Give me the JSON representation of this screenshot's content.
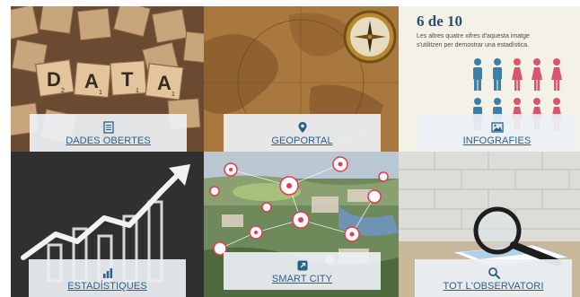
{
  "tiles": [
    {
      "label": "DADES OBERTES",
      "icon": "document-list-icon"
    },
    {
      "label": "GEOPORTAL",
      "icon": "map-pin-icon"
    },
    {
      "label": "INFOGRAFIES",
      "icon": "image-icon"
    },
    {
      "label": "ESTADÍSTIQUES",
      "icon": "bar-chart-icon"
    },
    {
      "label": "SMART CITY",
      "icon": "external-link-icon"
    },
    {
      "label": "TOT L'OBSERVATORI",
      "icon": "search-icon"
    }
  ],
  "data_blocks": {
    "d": "D",
    "d_sub": "2",
    "a1": "A",
    "a1_sub": "1",
    "t": "T",
    "t_sub": "1",
    "a2": "A",
    "a2_sub": "1"
  },
  "infographic": {
    "headline": "6 de 10",
    "caption_line1": "Les altres quatre xifres d'aquesta imatge",
    "caption_line2": "s'utilitzen per demostrar una estadística."
  },
  "colors": {
    "label_text": "#2a5f86",
    "male_figure": "#3d7fa6",
    "female_figure": "#d9556f",
    "infographic_headline": "#2c4f73"
  }
}
